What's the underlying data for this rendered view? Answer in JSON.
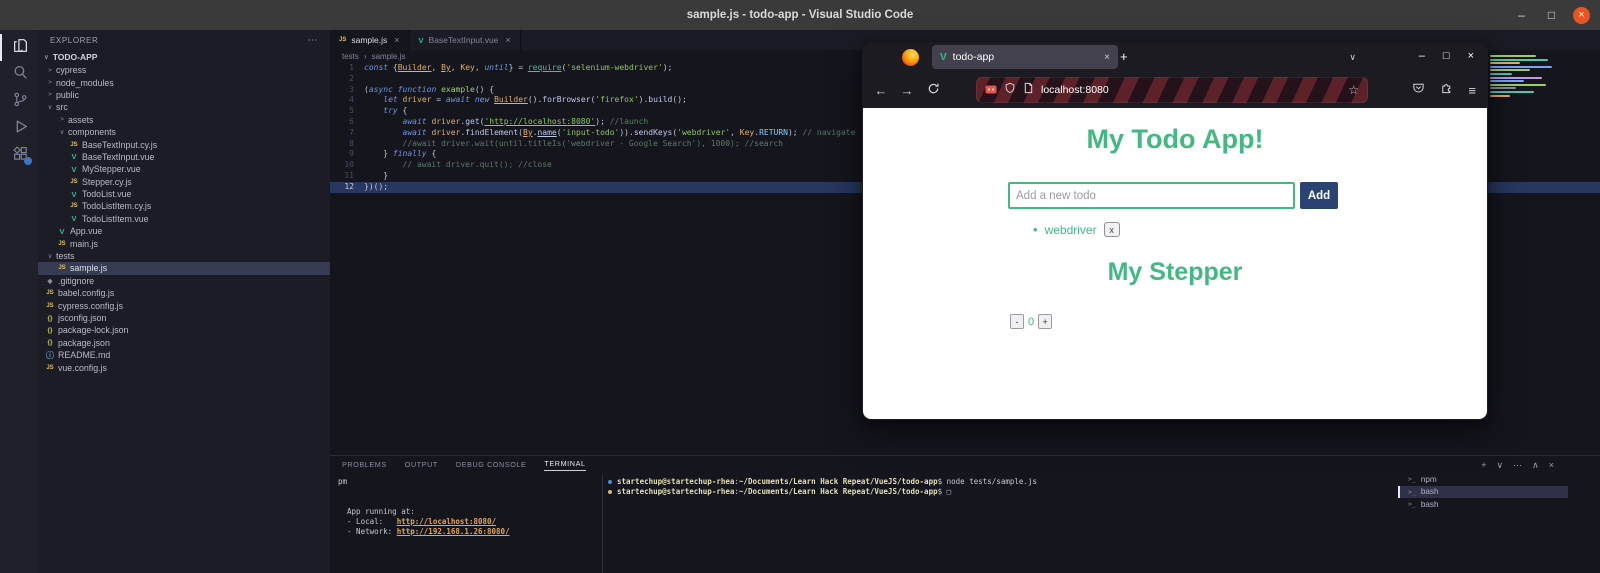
{
  "colors": {
    "vue_green": "#42b983",
    "add_button_bg": "#2a4373",
    "accent_blue": "#3d8fe0",
    "close_orange": "#e95420"
  },
  "titlebar": {
    "title": "sample.js - todo-app - Visual Studio Code",
    "minimize": "–",
    "maximize": "□",
    "close": "×"
  },
  "activity_bar": {
    "items": [
      {
        "name": "explorer",
        "active": true
      },
      {
        "name": "search",
        "active": false
      },
      {
        "name": "source-control",
        "active": false
      },
      {
        "name": "run-debug",
        "active": false
      },
      {
        "name": "extensions",
        "active": false,
        "badge": true
      }
    ]
  },
  "explorer": {
    "header": "EXPLORER",
    "more": "⋯",
    "section": "TODO-APP",
    "items": [
      {
        "label": "cypress",
        "icon": "folder",
        "indent": 0,
        "chevron": "right"
      },
      {
        "label": "node_modules",
        "icon": "folder",
        "indent": 0,
        "chevron": "right"
      },
      {
        "label": "public",
        "icon": "folder",
        "indent": 0,
        "chevron": "right"
      },
      {
        "label": "src",
        "icon": "folder",
        "indent": 0,
        "chevron": "down"
      },
      {
        "label": "assets",
        "icon": "folder",
        "indent": 1,
        "chevron": "right"
      },
      {
        "label": "components",
        "icon": "folder",
        "indent": 1,
        "chevron": "down"
      },
      {
        "label": "BaseTextInput.cy.js",
        "icon": "js",
        "indent": 2
      },
      {
        "label": "BaseTextInput.vue",
        "icon": "vue",
        "indent": 2
      },
      {
        "label": "MyStepper.vue",
        "icon": "vue",
        "indent": 2
      },
      {
        "label": "Stepper.cy.js",
        "icon": "js",
        "indent": 2
      },
      {
        "label": "TodoList.vue",
        "icon": "vue",
        "indent": 2
      },
      {
        "label": "TodoListItem.cy.js",
        "icon": "js",
        "indent": 2
      },
      {
        "label": "TodoListItem.vue",
        "icon": "vue",
        "indent": 2
      },
      {
        "label": "App.vue",
        "icon": "vue",
        "indent": 1
      },
      {
        "label": "main.js",
        "icon": "js",
        "indent": 1
      },
      {
        "label": "tests",
        "icon": "folder",
        "indent": 0,
        "chevron": "down"
      },
      {
        "label": "sample.js",
        "icon": "js",
        "indent": 1,
        "selected": true
      },
      {
        "label": ".gitignore",
        "icon": "git",
        "indent": 0
      },
      {
        "label": "babel.config.js",
        "icon": "js",
        "indent": 0
      },
      {
        "label": "cypress.config.js",
        "icon": "js",
        "indent": 0
      },
      {
        "label": "jsconfig.json",
        "icon": "json",
        "indent": 0
      },
      {
        "label": "package-lock.json",
        "icon": "json",
        "indent": 0
      },
      {
        "label": "package.json",
        "icon": "json",
        "indent": 0
      },
      {
        "label": "README.md",
        "icon": "info",
        "indent": 0
      },
      {
        "label": "vue.config.js",
        "icon": "js",
        "indent": 0
      }
    ]
  },
  "editor": {
    "tabs": [
      {
        "label": "sample.js",
        "icon": "js",
        "active": true,
        "close": "×"
      },
      {
        "label": "BaseTextInput.vue",
        "icon": "vue",
        "active": false,
        "close": "×"
      }
    ],
    "breadcrumb": [
      "tests",
      "sample.js"
    ],
    "breadcrumb_sep": "›",
    "current_line": 12,
    "lines": [
      [
        [
          "kw",
          "const"
        ],
        [
          "pn",
          " {"
        ],
        [
          "idu",
          "Builder"
        ],
        [
          "pn",
          ", "
        ],
        [
          "idu",
          "By"
        ],
        [
          "pn",
          ", "
        ],
        [
          "id",
          "Key"
        ],
        [
          "pn",
          ", "
        ],
        [
          "kw",
          "until"
        ],
        [
          "pn",
          "} = "
        ],
        [
          "requ",
          "require"
        ],
        [
          "pn",
          "("
        ],
        [
          "str",
          "'selenium-webdriver'"
        ],
        [
          "pn",
          ");"
        ]
      ],
      [],
      [
        [
          "pn",
          "("
        ],
        [
          "kw",
          "async function"
        ],
        [
          "pn",
          " "
        ],
        [
          "fn",
          "example"
        ],
        [
          "pn",
          "() {"
        ]
      ],
      [
        [
          "pn",
          "    "
        ],
        [
          "kw",
          "let"
        ],
        [
          "pn",
          " "
        ],
        [
          "id",
          "driver"
        ],
        [
          "pn",
          " = "
        ],
        [
          "kw",
          "await"
        ],
        [
          "pn",
          " "
        ],
        [
          "kw",
          "new"
        ],
        [
          "pn",
          " "
        ],
        [
          "idu",
          "Builder"
        ],
        [
          "pn",
          "()."
        ],
        [
          "m",
          "forBrowser"
        ],
        [
          "pn",
          "("
        ],
        [
          "str",
          "'firefox'"
        ],
        [
          "pn",
          ")."
        ],
        [
          "m",
          "build"
        ],
        [
          "pn",
          "();"
        ]
      ],
      [
        [
          "pn",
          "    "
        ],
        [
          "kw",
          "try"
        ],
        [
          "pn",
          " {"
        ]
      ],
      [
        [
          "pn",
          "        "
        ],
        [
          "kw",
          "await"
        ],
        [
          "pn",
          " "
        ],
        [
          "id",
          "driver"
        ],
        [
          "pn",
          "."
        ],
        [
          "m",
          "get"
        ],
        [
          "pn",
          "("
        ],
        [
          "stru",
          "'http://localhost:8080'"
        ],
        [
          "pn",
          "); "
        ],
        [
          "cm",
          "//launch"
        ]
      ],
      [
        [
          "pn",
          "        "
        ],
        [
          "kw",
          "await"
        ],
        [
          "pn",
          " "
        ],
        [
          "id",
          "driver"
        ],
        [
          "pn",
          "."
        ],
        [
          "m",
          "findElement"
        ],
        [
          "pn",
          "("
        ],
        [
          "idu",
          "By"
        ],
        [
          "pn",
          "."
        ],
        [
          "mu",
          "name"
        ],
        [
          "pn",
          "("
        ],
        [
          "str",
          "'input-todo'"
        ],
        [
          "pn",
          "))."
        ],
        [
          "m",
          "sendKeys"
        ],
        [
          "pn",
          "("
        ],
        [
          "str",
          "'webdriver'"
        ],
        [
          "pn",
          ", "
        ],
        [
          "id",
          "Key"
        ],
        [
          "pn",
          "."
        ],
        [
          "cn",
          "RETURN"
        ],
        [
          "pn",
          "); "
        ],
        [
          "cm",
          "// navigate"
        ]
      ],
      [
        [
          "pn",
          "        "
        ],
        [
          "cm",
          "//await driver.wait(until.titleIs('webdriver - Google Search'), 1000); //search"
        ]
      ],
      [
        [
          "pn",
          "    } "
        ],
        [
          "kw",
          "finally"
        ],
        [
          "pn",
          " {"
        ]
      ],
      [
        [
          "pn",
          "        "
        ],
        [
          "cm",
          "// await driver.quit(); //close"
        ]
      ],
      [
        [
          "pn",
          "    }"
        ]
      ],
      [
        [
          "pn",
          "})();"
        ]
      ]
    ]
  },
  "panel": {
    "tabs": [
      {
        "label": "PROBLEMS",
        "active": false
      },
      {
        "label": "OUTPUT",
        "active": false
      },
      {
        "label": "DEBUG CONSOLE",
        "active": false
      },
      {
        "label": "TERMINAL",
        "active": true
      }
    ],
    "actions": [
      "+",
      "∨",
      "⋯",
      "∧",
      "×"
    ],
    "left_terminal_lines": [
      [
        [
          "t",
          "pm"
        ]
      ],
      [],
      [],
      [
        [
          "t",
          "  App running at:"
        ]
      ],
      [
        [
          "t",
          "  - Local:   "
        ],
        [
          "url",
          "http://localhost:8080/"
        ]
      ],
      [
        [
          "t",
          "  - Network: "
        ],
        [
          "url",
          "http://192.168.1.26:8080/"
        ]
      ]
    ],
    "right_terminal_lines": [
      [
        [
          "dotb",
          ""
        ],
        [
          "usr",
          "startechup@startechup-rhea"
        ],
        [
          "t",
          ":"
        ],
        [
          "path",
          "~/Documents/Learn Hack Repeat/VueJS/todo-app"
        ],
        [
          "t",
          "$ "
        ],
        [
          "t",
          "node tests/sample.js"
        ]
      ],
      [
        [
          "doty",
          ""
        ],
        [
          "usr",
          "startechup@startechup-rhea"
        ],
        [
          "t",
          ":"
        ],
        [
          "path",
          "~/Documents/Learn Hack Repeat/VueJS/todo-app"
        ],
        [
          "t",
          "$ "
        ],
        [
          "blk",
          "□"
        ]
      ]
    ],
    "terminals": [
      {
        "label": "npm",
        "active": false
      },
      {
        "label": "bash",
        "active": true
      },
      {
        "label": "bash",
        "active": false
      }
    ]
  },
  "firefox": {
    "tab_label": "todo-app",
    "tab_close": "×",
    "new_tab": "+",
    "tabs_chevron": "∨",
    "minimize": "–",
    "maximize": "□",
    "close": "×",
    "back": "←",
    "forward": "→",
    "url": "localhost:8080",
    "star": "☆",
    "menu_icon": "≡",
    "page": {
      "todo_title": "My Todo App!",
      "input_placeholder": "Add a new todo",
      "add_label": "Add",
      "todos": [
        {
          "label": "webdriver",
          "remove_label": "x"
        }
      ],
      "stepper_title": "My Stepper",
      "stepper_minus": "-",
      "stepper_value": "0",
      "stepper_plus": "+"
    }
  }
}
